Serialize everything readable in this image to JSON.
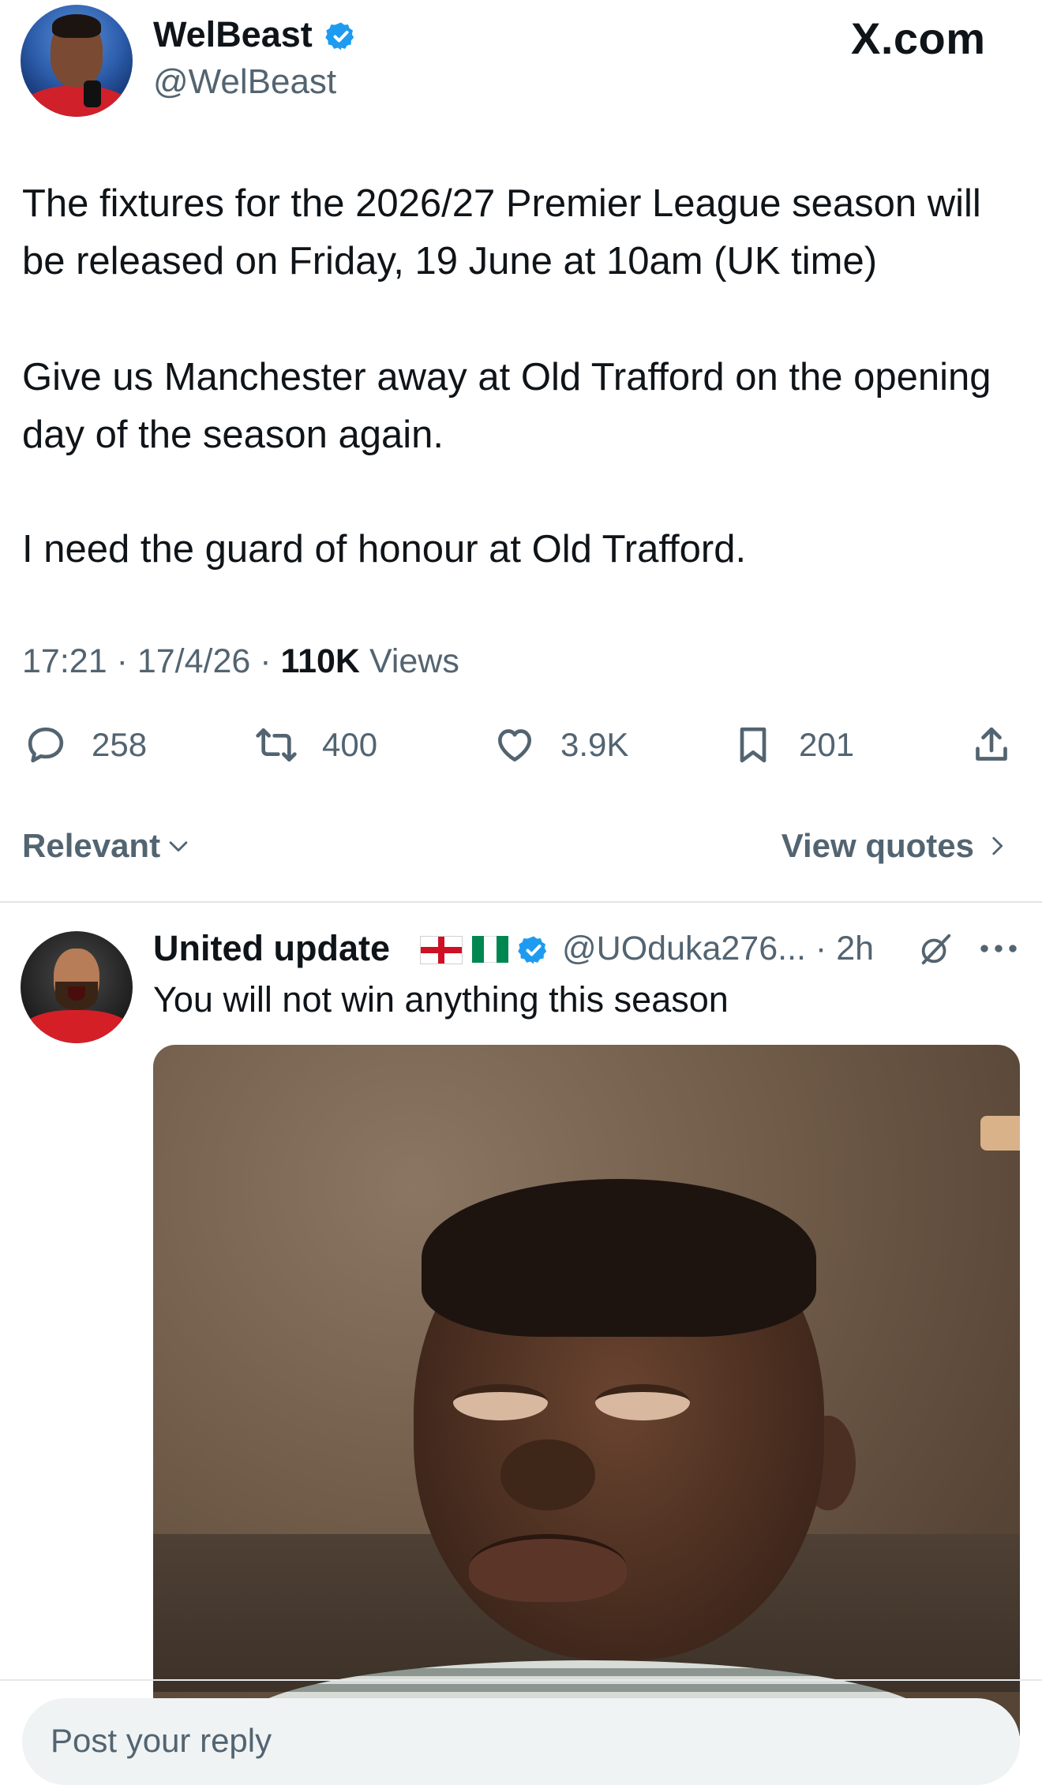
{
  "tweet": {
    "author_name": "WelBeast",
    "author_handle": "@WelBeast",
    "site": "X.com",
    "paragraphs": [
      "The fixtures for the 2026/27 Premier League season will be released on Friday, 19 June at 10am (UK time)",
      "Give us Manchester away at Old Trafford on the opening day of the season again.",
      "I need the guard of honour at Old Trafford."
    ],
    "time": "17:21",
    "date": "17/4/26",
    "views_count": "110K",
    "views_label": "Views",
    "sep": "·"
  },
  "actions": {
    "replies": "258",
    "reposts": "400",
    "likes": "3.9K",
    "bookmarks": "201"
  },
  "sort": {
    "label": "Relevant",
    "view_quotes": "View quotes"
  },
  "reply": {
    "name": "United update",
    "handle": "@UOduka276... · 2h",
    "text": "You will not win anything this season"
  },
  "composer": {
    "placeholder": "Post your reply"
  },
  "colors": {
    "verified": "#1d9bf0",
    "muted": "#536471",
    "text": "#0f1419"
  },
  "icons": {
    "reply": "speech-bubble-icon",
    "repost": "repost-icon",
    "like": "heart-icon",
    "bookmark": "bookmark-icon",
    "share": "share-icon",
    "grok": "grok-icon",
    "more": "more-icon"
  }
}
